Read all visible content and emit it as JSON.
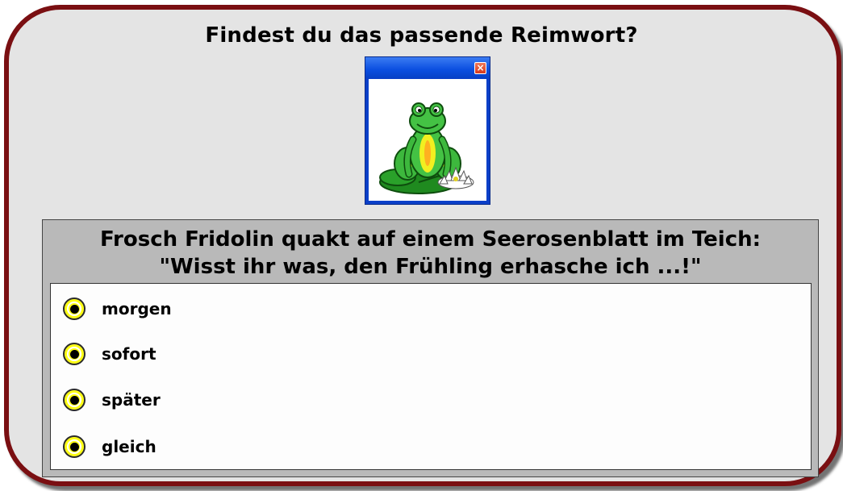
{
  "title": "Findest du das passende Reimwort?",
  "image_window": {
    "close_symbol": "×",
    "image": "frog-on-lily-pad"
  },
  "question": {
    "line1": "Frosch Fridolin quakt auf einem Seerosenblatt im Teich:",
    "line2": "\"Wisst ihr was, den Frühling erhasche ich ...!\""
  },
  "options": [
    {
      "label": "morgen"
    },
    {
      "label": "sofort"
    },
    {
      "label": "später"
    },
    {
      "label": "gleich"
    }
  ],
  "colors": {
    "frame_border": "#7a0f12",
    "frame_fill": "#e4e4e4",
    "panel_fill": "#b9b9b9",
    "radio_fill": "#ffff14",
    "window_blue": "#0b3fc8"
  }
}
